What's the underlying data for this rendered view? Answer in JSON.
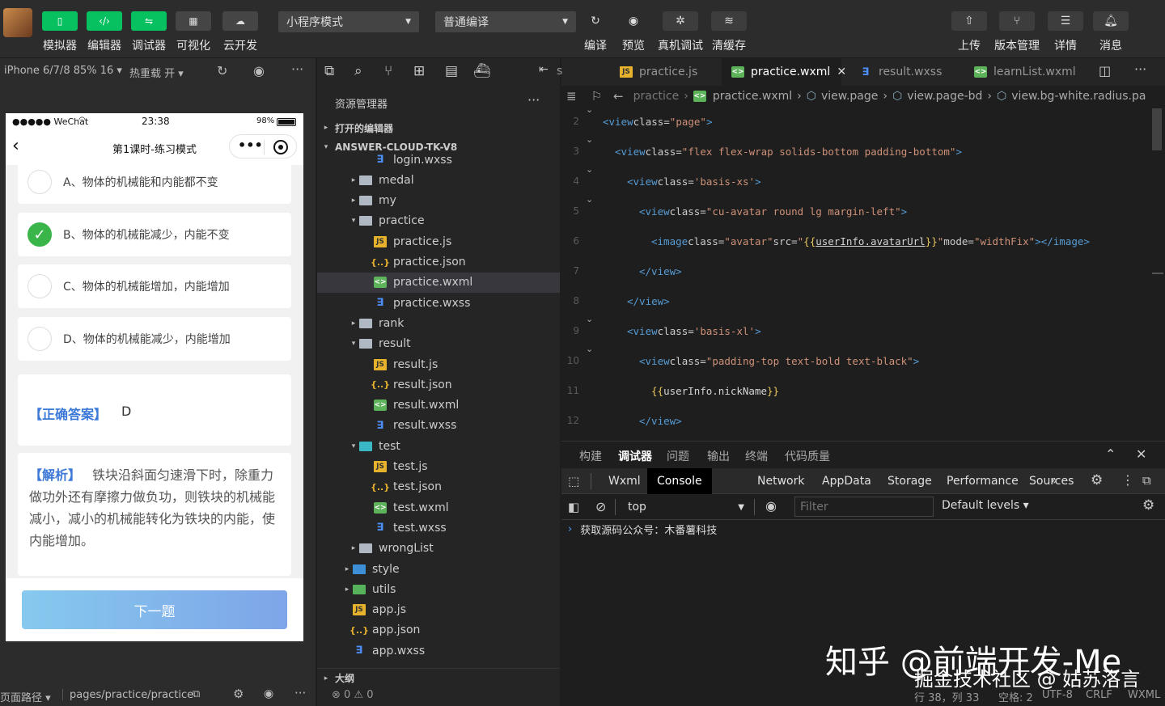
{
  "toolbar": {
    "left_buttons": [
      {
        "label": "模拟器",
        "icon": "phone-icon"
      },
      {
        "label": "编辑器",
        "icon": "code-icon"
      },
      {
        "label": "调试器",
        "icon": "debug-icon"
      },
      {
        "label": "可视化",
        "icon": "layout-icon"
      },
      {
        "label": "云开发",
        "icon": "cloud-icon"
      }
    ],
    "mode_select": "小程序模式",
    "compile_select": "普通编译",
    "mid_buttons": [
      {
        "label": "编译",
        "icon": "refresh-icon"
      },
      {
        "label": "预览",
        "icon": "eye-icon"
      },
      {
        "label": "真机调试",
        "icon": "bug-icon"
      },
      {
        "label": "清缓存",
        "icon": "layers-icon"
      }
    ],
    "right_buttons": [
      {
        "label": "上传",
        "icon": "upload-icon"
      },
      {
        "label": "版本管理",
        "icon": "branch-icon"
      },
      {
        "label": "详情",
        "icon": "menu-icon"
      },
      {
        "label": "消息",
        "icon": "bell-icon"
      }
    ]
  },
  "simulator": {
    "device": "iPhone 6/7/8 85% 16 ▾",
    "hotreload": "热重载 开 ▾",
    "statusbar": {
      "carrier": "●●●●● WeChat",
      "time": "23:38",
      "battery": "98%"
    },
    "nav_title": "第1课时-练习模式",
    "options": [
      {
        "text": "A、物体的机械能和内能都不变",
        "checked": false
      },
      {
        "text": "B、物体的机械能减少，内能不变",
        "checked": true
      },
      {
        "text": "C、物体的机械能增加，内能增加",
        "checked": false
      },
      {
        "text": "D、物体的机械能减少，内能增加",
        "checked": false
      }
    ],
    "answer_label": "【正确答案】",
    "answer_value": "D",
    "analysis_label": "【解析】",
    "analysis_text": "铁块沿斜面匀速滑下时，除重力做功外还有摩擦力做负功，则铁块的机械能减小，减小的机械能转化为铁块的内能，使内能增加。",
    "next_button": "下一题",
    "footer_label": "页面路径 ▾",
    "footer_path": "pages/practice/practice"
  },
  "explorer": {
    "title": "资源管理器",
    "open_editors": "打开的编辑器",
    "project": "ANSWER-CLOUD-TK-V8",
    "outline": "大纲",
    "problems": "⊗ 0 ⚠ 0",
    "items": [
      {
        "name": "login.wxss",
        "type": "wxss",
        "depth": 2,
        "arrow": ""
      },
      {
        "name": "medal",
        "type": "dir",
        "depth": 1,
        "arrow": "▸"
      },
      {
        "name": "my",
        "type": "dir",
        "depth": 1,
        "arrow": "▸"
      },
      {
        "name": "practice",
        "type": "dir",
        "depth": 1,
        "arrow": "▾"
      },
      {
        "name": "practice.js",
        "type": "js",
        "depth": 2,
        "arrow": ""
      },
      {
        "name": "practice.json",
        "type": "json",
        "depth": 2,
        "arrow": ""
      },
      {
        "name": "practice.wxml",
        "type": "wxml",
        "depth": 2,
        "arrow": "",
        "selected": true
      },
      {
        "name": "practice.wxss",
        "type": "wxss",
        "depth": 2,
        "arrow": ""
      },
      {
        "name": "rank",
        "type": "dir",
        "depth": 1,
        "arrow": "▸"
      },
      {
        "name": "result",
        "type": "dir",
        "depth": 1,
        "arrow": "▾"
      },
      {
        "name": "result.js",
        "type": "js",
        "depth": 2,
        "arrow": ""
      },
      {
        "name": "result.json",
        "type": "json",
        "depth": 2,
        "arrow": ""
      },
      {
        "name": "result.wxml",
        "type": "wxml",
        "depth": 2,
        "arrow": ""
      },
      {
        "name": "result.wxss",
        "type": "wxss",
        "depth": 2,
        "arrow": ""
      },
      {
        "name": "test",
        "type": "dirt",
        "depth": 1,
        "arrow": "▾"
      },
      {
        "name": "test.js",
        "type": "js",
        "depth": 2,
        "arrow": ""
      },
      {
        "name": "test.json",
        "type": "json",
        "depth": 2,
        "arrow": ""
      },
      {
        "name": "test.wxml",
        "type": "wxml",
        "depth": 2,
        "arrow": ""
      },
      {
        "name": "test.wxss",
        "type": "wxss",
        "depth": 2,
        "arrow": ""
      },
      {
        "name": "wrongList",
        "type": "dir",
        "depth": 1,
        "arrow": "▸"
      },
      {
        "name": "style",
        "type": "dirb",
        "depth": 0,
        "arrow": "▸"
      },
      {
        "name": "utils",
        "type": "dirg",
        "depth": 0,
        "arrow": "▸"
      },
      {
        "name": "app.js",
        "type": "js",
        "depth": 0,
        "arrow": ""
      },
      {
        "name": "app.json",
        "type": "json",
        "depth": 0,
        "arrow": ""
      },
      {
        "name": "app.wxss",
        "type": "wxss",
        "depth": 0,
        "arrow": ""
      }
    ]
  },
  "editor": {
    "tabs": [
      {
        "name": "practice.js",
        "type": "js"
      },
      {
        "name": "practice.wxml",
        "type": "wxml",
        "active": true
      },
      {
        "name": "result.wxss",
        "type": "wxss"
      },
      {
        "name": "learnList.wxml",
        "type": "wxml"
      }
    ],
    "breadcrumb": [
      "practice",
      "practice.wxml",
      "view.page",
      "view.page-bd",
      "view.bg-white.radius.pa"
    ],
    "lines": [
      {
        "n": "2",
        "indent": 0,
        "fold": true,
        "html": "<span class='tg'>&lt;view</span> <span class='at'>class=</span><span class='st'>\"page\"</span><span class='tg'>&gt;</span>"
      },
      {
        "n": "3",
        "indent": 1,
        "fold": true,
        "html": "<span class='tg'>&lt;view</span> <span class='at'>class=</span><span class='st'>\"flex flex-wrap solids-bottom padding-bottom\"</span><span class='tg'>&gt;</span>"
      },
      {
        "n": "4",
        "indent": 2,
        "fold": true,
        "html": "<span class='tg'>&lt;view</span> <span class='at'>class=</span><span class='st'>'basis-xs'</span><span class='tg'>&gt;</span>"
      },
      {
        "n": "5",
        "indent": 3,
        "fold": true,
        "html": "<span class='tg'>&lt;view</span> <span class='at'>class=</span><span class='st'>\"cu-avatar round lg margin-left\"</span><span class='tg'>&gt;</span>"
      },
      {
        "n": "6",
        "indent": 4,
        "fold": false,
        "html": "<span class='tg'>&lt;image</span> <span class='at'>class=</span><span class='st'>\"avatar\"</span> <span class='at'>src=</span><span class='st'>\"</span><span class='br'>{{</span><span class='pl' style='text-decoration:underline'>userInfo.avatarUrl</span><span class='br'>}}</span><span class='st'>\"</span> <span class='at'>mode=</span><span class='st'>\"widthFix\"</span><span class='tg'>&gt;&lt;/image&gt;</span>"
      },
      {
        "n": "7",
        "indent": 3,
        "fold": false,
        "html": "<span class='tg'>&lt;/view&gt;</span>"
      },
      {
        "n": "8",
        "indent": 2,
        "fold": false,
        "html": "<span class='tg'>&lt;/view&gt;</span>"
      },
      {
        "n": "9",
        "indent": 2,
        "fold": true,
        "html": "<span class='tg'>&lt;view</span> <span class='at'>class=</span><span class='st'>'basis-xl'</span><span class='tg'>&gt;</span>"
      },
      {
        "n": "10",
        "indent": 3,
        "fold": true,
        "html": "<span class='tg'>&lt;view</span> <span class='at'>class=</span><span class='st'>\"padding-top text-bold text-black\"</span><span class='tg'>&gt;</span>"
      },
      {
        "n": "11",
        "indent": 4,
        "fold": false,
        "html": "<span class='br'>{{</span><span class='pl'>userInfo.nickName</span><span class='br'>}}</span>"
      },
      {
        "n": "12",
        "indent": 3,
        "fold": false,
        "html": "<span class='tg'>&lt;/view&gt;</span>"
      }
    ]
  },
  "devtools": {
    "top_tabs": [
      {
        "label": "构建"
      },
      {
        "label": "调试器",
        "active": true
      },
      {
        "label": "问题"
      },
      {
        "label": "输出"
      },
      {
        "label": "终端"
      },
      {
        "label": "代码质量"
      }
    ],
    "panel_tabs": [
      {
        "label": "Wxml"
      },
      {
        "label": "Console",
        "active": true
      },
      {
        "label": "Network"
      },
      {
        "label": "AppData"
      },
      {
        "label": "Storage"
      },
      {
        "label": "Performance"
      },
      {
        "label": "Sources"
      }
    ],
    "context": "top",
    "filter_placeholder": "Filter",
    "levels": "Default levels ▾",
    "console_line": "获取源码公众号：木番薯科技"
  },
  "status": {
    "position": "行 38，列 33",
    "spaces": "空格: 2",
    "encoding": "UTF-8",
    "eol": "CRLF",
    "lang": "WXML"
  },
  "watermark": {
    "line1": "知乎 @前端开发-Me",
    "line2": "掘金技术社区 @ 姑苏洛言"
  },
  "colors": {
    "accent": "#07c160",
    "link_blue": "#3a8ee6",
    "answer_blue": "#3c78d8",
    "button_grad_start": "#86c9ee",
    "button_grad_end": "#7ea5e8"
  }
}
